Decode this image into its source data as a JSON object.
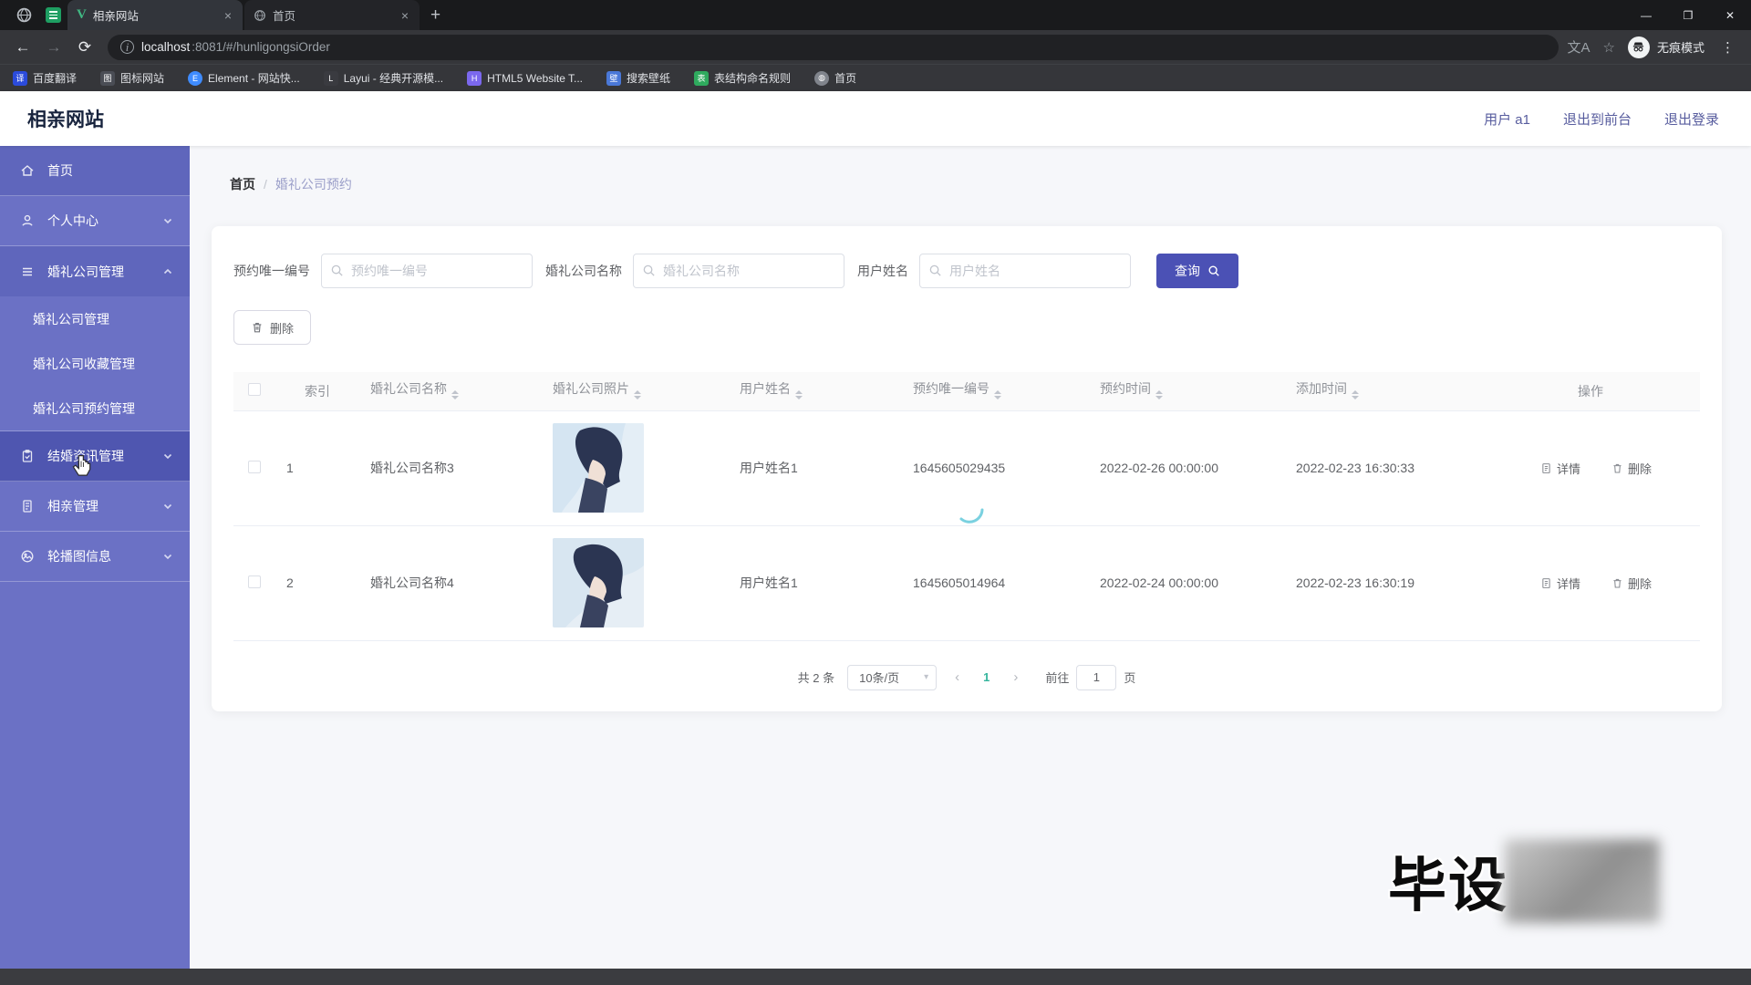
{
  "colors": {
    "sidebar": "#6b71c5",
    "accent": "#4b51b5",
    "pagination_active": "#35b59d",
    "header_link": "#575c9e"
  },
  "browser": {
    "tabs": [
      {
        "title": "相亲网站",
        "icon": "vue-icon"
      },
      {
        "title": "首页",
        "icon": "globe-icon"
      }
    ],
    "url_host": "localhost",
    "url_rest": ":8081/#/hunligongsiOrder",
    "incognito_label": "无痕模式",
    "bookmarks": [
      {
        "label": "百度翻译",
        "glyph": "译",
        "color": "#2b4bdb"
      },
      {
        "label": "图标网站",
        "glyph": "图",
        "color": "#4a4d55"
      },
      {
        "label": "Element - 网站快...",
        "glyph": "E",
        "color": "#3f8cff"
      },
      {
        "label": "Layui - 经典开源模...",
        "glyph": "L",
        "color": "#3a3b40"
      },
      {
        "label": "HTML5 Website T...",
        "glyph": "H",
        "color": "#7b68ee"
      },
      {
        "label": "搜索壁纸",
        "glyph": "壁",
        "color": "#4a78d8"
      },
      {
        "label": "表结构命名规则",
        "glyph": "表",
        "color": "#2faa5e"
      },
      {
        "label": "首页",
        "glyph": "◍",
        "color": "#80848c"
      }
    ]
  },
  "app_header": {
    "title": "相亲网站",
    "user": "用户 a1",
    "exit_front": "退出到前台",
    "logout": "退出登录"
  },
  "sidebar": {
    "items": [
      {
        "label": "首页"
      },
      {
        "label": "个人中心"
      },
      {
        "label": "婚礼公司管理",
        "children": [
          "婚礼公司管理",
          "婚礼公司收藏管理",
          "婚礼公司预约管理"
        ]
      },
      {
        "label": "结婚资讯管理"
      },
      {
        "label": "相亲管理"
      },
      {
        "label": "轮播图信息"
      }
    ]
  },
  "breadcrumb": {
    "home": "首页",
    "separator": "/",
    "current": "婚礼公司预约"
  },
  "filters": {
    "fields": [
      {
        "label": "预约唯一编号",
        "placeholder": "预约唯一编号",
        "value": ""
      },
      {
        "label": "婚礼公司名称",
        "placeholder": "婚礼公司名称",
        "value": ""
      },
      {
        "label": "用户姓名",
        "placeholder": "用户姓名",
        "value": ""
      }
    ],
    "search_label": "查询"
  },
  "toolbar": {
    "delete_label": "删除"
  },
  "table": {
    "headers": [
      "索引",
      "婚礼公司名称",
      "婚礼公司照片",
      "用户姓名",
      "预约唯一编号",
      "预约时间",
      "添加时间",
      "操作"
    ],
    "rows": [
      {
        "index": "1",
        "company": "婚礼公司名称3",
        "user": "用户姓名1",
        "order_no": "1645605029435",
        "order_time": "2022-02-26 00:00:00",
        "add_time": "2022-02-23 16:30:33",
        "detail_label": "详情",
        "delete_label": "删除"
      },
      {
        "index": "2",
        "company": "婚礼公司名称4",
        "user": "用户姓名1",
        "order_no": "1645605014964",
        "order_time": "2022-02-24 00:00:00",
        "add_time": "2022-02-23 16:30:19",
        "detail_label": "详情",
        "delete_label": "删除"
      }
    ]
  },
  "pagination": {
    "total": "共 2 条",
    "page_size": "10条/页",
    "prev": "‹",
    "page": "1",
    "next": "›",
    "goto_label": "前往",
    "goto_value": "1",
    "page_unit": "页"
  },
  "watermark": {
    "text": "毕设"
  }
}
